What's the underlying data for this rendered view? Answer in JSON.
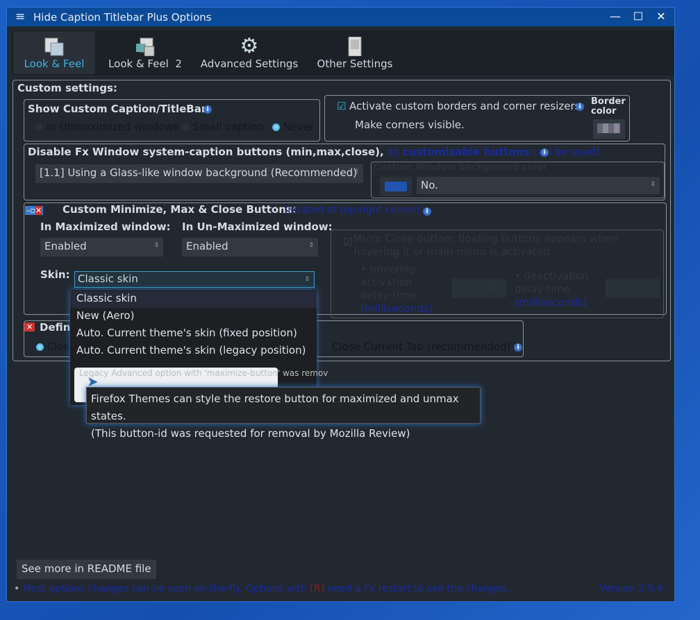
{
  "window": {
    "title": "Hide Caption Titlebar Plus Options",
    "controls": {
      "minimize": "—",
      "maximize": "☐",
      "close": "✕"
    }
  },
  "tabs": [
    {
      "label": "Look & Feel",
      "selected": true
    },
    {
      "label": "Look & Feel  2"
    },
    {
      "label": "Advanced Settings"
    },
    {
      "label": "Other Settings"
    }
  ],
  "custom_settings": {
    "heading": "Custom settings:",
    "show_caption": {
      "label": "Show Custom Caption/TitleBar:",
      "options": [
        "In Unmaximized windows",
        "Small caption",
        "Never"
      ],
      "selected": "Never"
    },
    "borders": {
      "activate_label": "Activate custom borders and corner resizers",
      "activate_checked": true,
      "corners_label": "Make corners visible.",
      "corners_checked": false,
      "border_color_label": "Border color"
    },
    "disable_fx": {
      "label": "Disable Fx Window system-caption buttons (min,max,close),",
      "note_pre": "so ",
      "note_bold": "customizable buttons",
      "note_post": " can be used!",
      "select_value": "[1.1] Using a Glass-like window background  (Recommended)",
      "bg_color_label": "Custom Window background color",
      "bg_color": "#1f55b0",
      "bg_select": "No."
    },
    "buttons": {
      "label": "Custom Minimize, Max & Close Buttons:",
      "note": "(located at top-right corner)",
      "max_label": "In Maximized window:",
      "max_value": "Enabled",
      "unmax_label": "In Un-Maximized window:",
      "unmax_value": "Enabled",
      "skin_label": "Skin:",
      "skin_value": "Classic skin",
      "micro": {
        "label": "Micro Close-button: floating buttons appears when hovering it or main menu is activated",
        "hover_label": "hovering activation delay-time",
        "hover_unit": "(milliseconds)",
        "hover_value": "0",
        "deact_label": "deactivation delay-time",
        "deact_unit": "(milliseconds)"
      }
    },
    "define": {
      "label": "Define",
      "option1": "Close",
      "option2": "Close Current Tab (recommended)"
    }
  },
  "skin_dropdown": [
    "Classic skin",
    "New (Aero)",
    "Auto. Current theme's skin (fixed position)",
    "Auto. Current theme's skin (legacy position)"
  ],
  "legacy_note": "Legacy Advanced option with 'maximize-button' was remov",
  "tooltip": {
    "line1": "Firefox Themes can style the restore button for maximized and unmax states.",
    "line2": "(This button-id was requested for removal by Mozilla Review)"
  },
  "footer": {
    "readme": "See more in README file",
    "note_pre": "Most options changes can be seen on-the-fly.   Options with ",
    "note_r": "[R]",
    "note_post": " need a Fx restart to see the changes.",
    "version": "Version 2.9.4"
  },
  "colors": {
    "accent": "#3fb0e0",
    "titlebar": "#0b4a98",
    "link": "#1a2aa0"
  }
}
